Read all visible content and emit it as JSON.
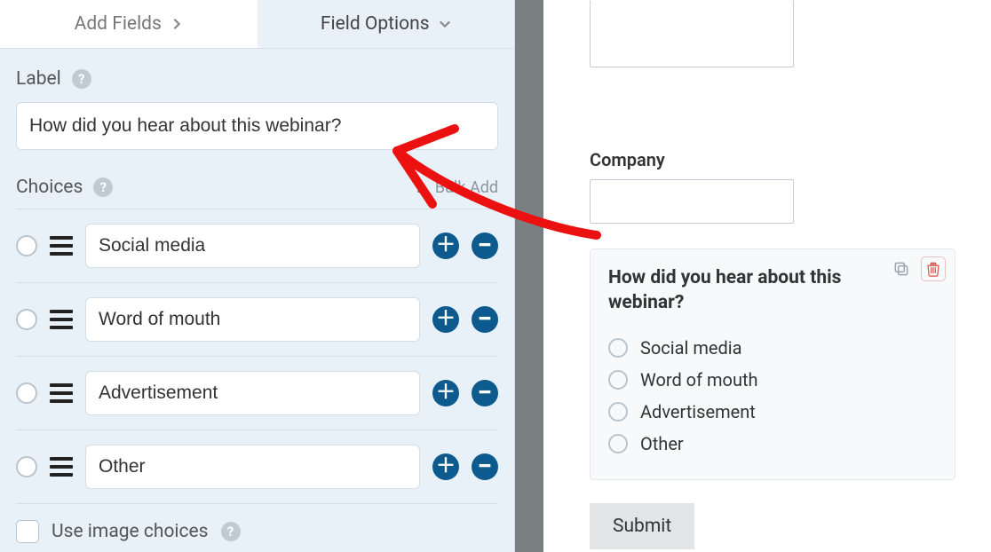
{
  "tabs": {
    "add_fields": "Add Fields",
    "field_options": "Field Options"
  },
  "label": {
    "title": "Label",
    "value": "How did you hear about this webinar?"
  },
  "choices": {
    "title": "Choices",
    "bulk_add": "Bulk Add",
    "items": [
      {
        "value": "Social media"
      },
      {
        "value": "Word of mouth"
      },
      {
        "value": "Advertisement"
      },
      {
        "value": "Other"
      }
    ]
  },
  "use_image_choices": "Use image choices",
  "preview": {
    "company_label": "Company",
    "question": "How did you hear about this webinar?",
    "options": [
      "Social media",
      "Word of mouth",
      "Advertisement",
      "Other"
    ],
    "submit": "Submit"
  },
  "colors": {
    "accent": "#0d5a8e",
    "panel_bg": "#e8f0f8",
    "gutter": "#7a7f82",
    "arrow": "#ec1111",
    "danger": "#d9534f"
  }
}
